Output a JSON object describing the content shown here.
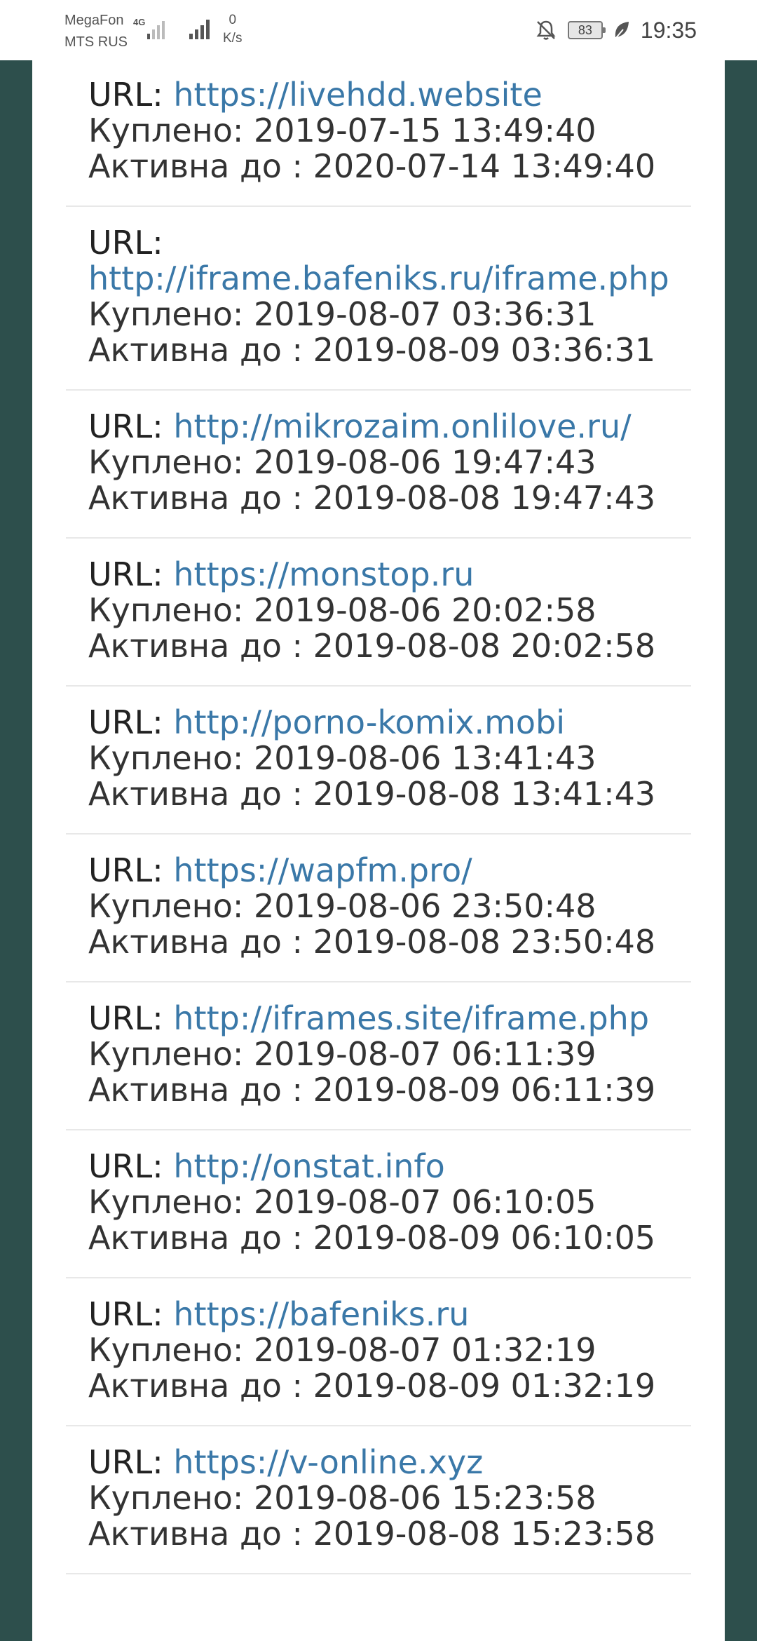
{
  "status_bar": {
    "carrier_1": "MegaFon",
    "carrier_2": "MTS RUS",
    "network_type": "4G",
    "speed_value": "0",
    "speed_unit": "K/s",
    "battery": "83",
    "time": "19:35"
  },
  "labels": {
    "url": "URL:",
    "bought": "Куплено:",
    "active_until": "Активна до :"
  },
  "entries": [
    {
      "url": "https://livehdd.website",
      "bought": "2019-07-15 13:49:40",
      "active_until": "2020-07-14 13:49:40"
    },
    {
      "url": "http://iframe.bafeniks.ru/iframe.php",
      "bought": "2019-08-07 03:36:31",
      "active_until": "2019-08-09 03:36:31"
    },
    {
      "url": "http://mikrozaim.onlilove.ru/",
      "bought": "2019-08-06 19:47:43",
      "active_until": "2019-08-08 19:47:43"
    },
    {
      "url": "https://monstop.ru",
      "bought": "2019-08-06 20:02:58",
      "active_until": "2019-08-08 20:02:58"
    },
    {
      "url": "http://porno-komix.mobi",
      "bought": "2019-08-06 13:41:43",
      "active_until": "2019-08-08 13:41:43"
    },
    {
      "url": "https://wapfm.pro/",
      "bought": "2019-08-06 23:50:48",
      "active_until": "2019-08-08 23:50:48"
    },
    {
      "url": "http://iframes.site/iframe.php",
      "bought": "2019-08-07 06:11:39",
      "active_until": "2019-08-09 06:11:39"
    },
    {
      "url": "http://onstat.info",
      "bought": "2019-08-07 06:10:05",
      "active_until": "2019-08-09 06:10:05"
    },
    {
      "url": "https://bafeniks.ru",
      "bought": "2019-08-07 01:32:19",
      "active_until": "2019-08-09 01:32:19"
    },
    {
      "url": "https://v-online.xyz",
      "bought": "2019-08-06 15:23:58",
      "active_until": "2019-08-08 15:23:58"
    }
  ],
  "colors": {
    "background": "#2d4f4c",
    "card": "#ffffff",
    "link": "#3a78a8",
    "text": "#333333",
    "divider": "#e8e8e8"
  }
}
